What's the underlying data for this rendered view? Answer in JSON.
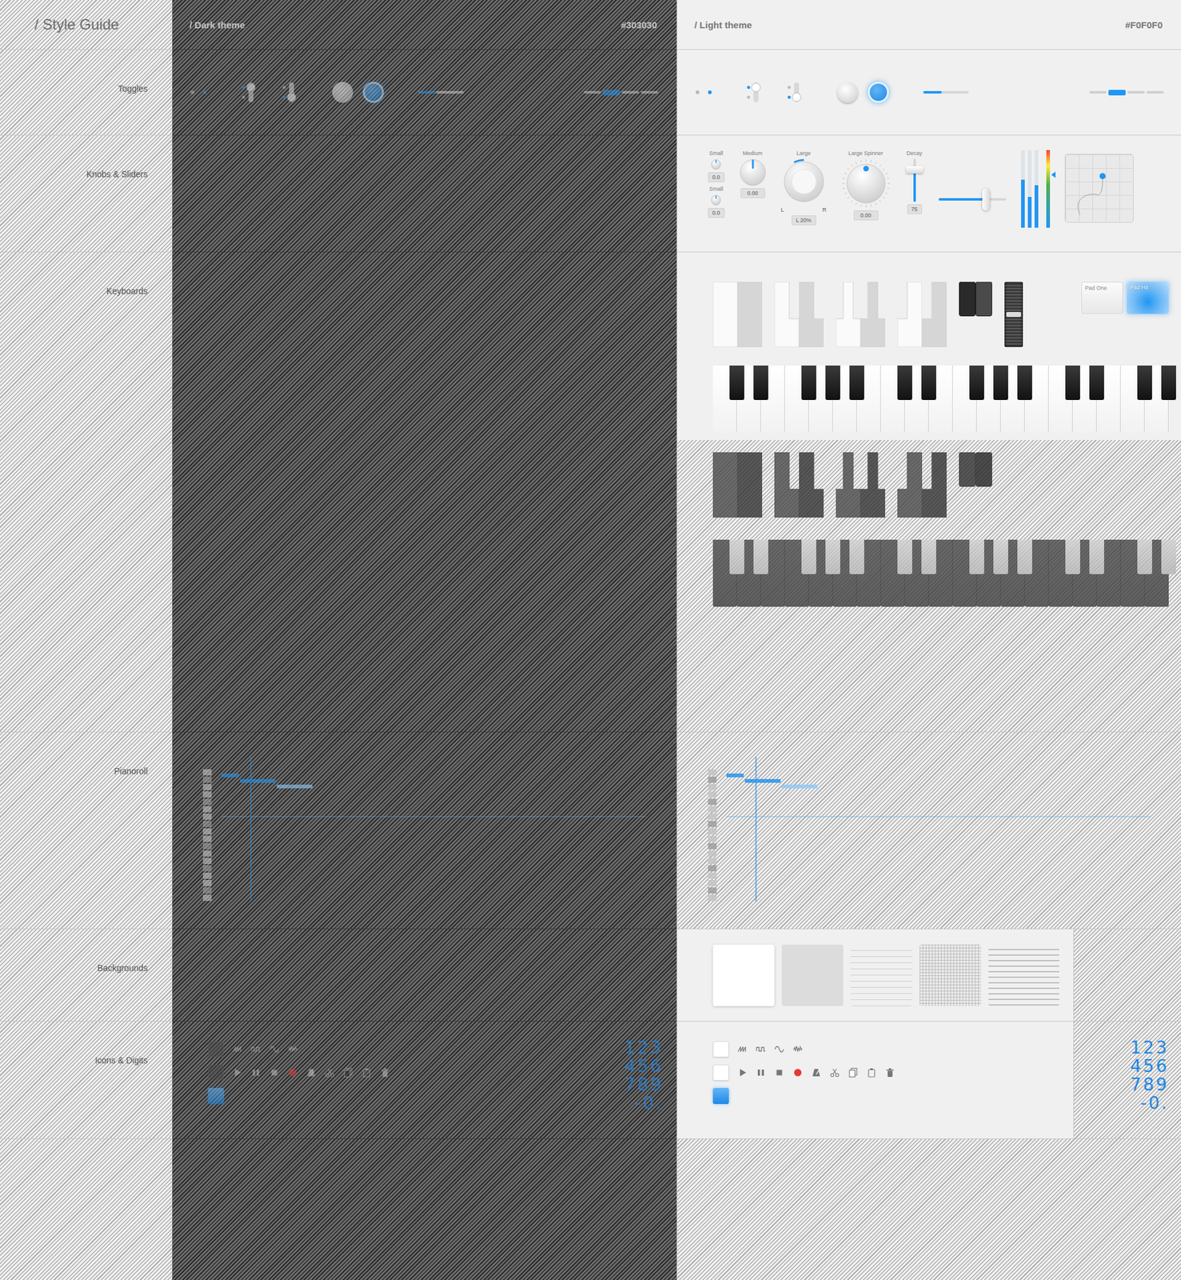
{
  "guide": {
    "title": "/ Style Guide",
    "sections": [
      "Toggles",
      "Knobs & Sliders",
      "Keyboards",
      "Pianoroll",
      "Backgrounds",
      "Icons & Digits"
    ]
  },
  "themes": [
    {
      "name": "/ Dark theme",
      "hex": "#303030",
      "kind": "dark"
    },
    {
      "name": "/ Light theme",
      "hex": "#F0F0F0",
      "kind": "light"
    }
  ],
  "toggles": {
    "dots": [
      {
        "on": false
      },
      {
        "on": true
      }
    ],
    "switches": [
      {
        "on": true
      },
      {
        "on": false
      }
    ],
    "buttons": [
      {
        "on": false
      },
      {
        "on": true
      }
    ],
    "slider": {
      "level": 0.4
    },
    "segments": [
      {
        "selected": false
      },
      {
        "selected": true
      },
      {
        "selected": false
      },
      {
        "selected": false
      }
    ]
  },
  "knobs": [
    {
      "kind": "small",
      "label": "Small",
      "value": "0.0",
      "level": 0.5
    },
    {
      "kind": "small",
      "label": "Small",
      "value": "0.0",
      "level": 0.5
    },
    {
      "kind": "medium",
      "label": "Medium",
      "value": "0.00",
      "level": 0.5
    },
    {
      "kind": "large",
      "label": "Large",
      "value": "L 20%",
      "level": 0.4,
      "marks": [
        "L",
        "R"
      ]
    },
    {
      "kind": "spinner",
      "label": "Large Spinner",
      "value": "0.00",
      "level": 0.5
    }
  ],
  "fader": {
    "label": "Decay",
    "value": "75",
    "level": 0.75
  },
  "hslider": {
    "level": 0.7
  },
  "meters": [
    {
      "kind": "mono",
      "level": 0.62
    },
    {
      "kind": "mono",
      "level": 0.4
    },
    {
      "kind": "mono",
      "level": 0.55
    },
    {
      "kind": "gradient",
      "level": 1.0,
      "peak": 0.68
    }
  ],
  "xypad": {
    "x": 0.55,
    "y": 0.32
  },
  "keyShapes": [
    {
      "kind": "plain",
      "keys": [
        {
          "pressed": false
        },
        {
          "pressed": true
        }
      ]
    },
    {
      "kind": "c",
      "keys": [
        {
          "pressed": false
        },
        {
          "pressed": true
        }
      ]
    },
    {
      "kind": "d",
      "keys": [
        {
          "pressed": false
        },
        {
          "pressed": true
        }
      ]
    },
    {
      "kind": "e",
      "keys": [
        {
          "pressed": false
        },
        {
          "pressed": true
        }
      ]
    },
    {
      "kind": "black",
      "keys": [
        {
          "pressed": false
        },
        {
          "pressed": true
        }
      ]
    }
  ],
  "pitchWheel": {
    "level": 0.5
  },
  "pads": [
    {
      "label": "Pad One",
      "selected": false
    },
    {
      "label": "Pad Hit",
      "selected": true
    }
  ],
  "piano": {
    "whiteKeys": [
      {
        "pressed": false
      },
      {
        "pressed": false
      },
      {
        "pressed": false
      },
      {
        "pressed": false
      },
      {
        "pressed": false
      },
      {
        "pressed": false
      },
      {
        "pressed": false
      },
      {
        "pressed": false
      },
      {
        "pressed": false
      },
      {
        "pressed": false
      },
      {
        "pressed": false
      },
      {
        "pressed": false
      },
      {
        "pressed": false
      },
      {
        "pressed": false
      },
      {
        "pressed": false
      },
      {
        "pressed": false
      },
      {
        "pressed": false
      },
      {
        "pressed": false
      },
      {
        "pressed": false
      }
    ]
  },
  "pianoroll": {
    "notes": [
      {
        "row": 3,
        "start": 0,
        "length": 1,
        "selected": true
      },
      {
        "row": 4,
        "start": 1,
        "length": 2,
        "selected": true
      },
      {
        "row": 5,
        "start": 3,
        "length": 2,
        "selected": false
      }
    ],
    "playhead": 1.6
  },
  "backgrounds": [
    {
      "kind": "plain"
    },
    {
      "kind": "grey"
    },
    {
      "kind": "lines"
    },
    {
      "kind": "grid"
    },
    {
      "kind": "rows"
    }
  ],
  "icons": {
    "rows": [
      {
        "box": {
          "checked": false
        },
        "items": [
          {
            "kind": "saw"
          },
          {
            "kind": "square"
          },
          {
            "kind": "sine"
          },
          {
            "kind": "noise"
          }
        ]
      },
      {
        "box": {
          "checked": false
        },
        "items": [
          {
            "kind": "play"
          },
          {
            "kind": "pause"
          },
          {
            "kind": "stop"
          },
          {
            "kind": "record",
            "color": "#e53935"
          },
          {
            "kind": "metronome"
          },
          {
            "kind": "cut"
          },
          {
            "kind": "copy"
          },
          {
            "kind": "paste"
          },
          {
            "kind": "delete"
          }
        ]
      },
      {
        "box": {
          "checked": true
        },
        "items": []
      }
    ]
  },
  "digits": [
    "123",
    "456",
    "789",
    "-0."
  ]
}
